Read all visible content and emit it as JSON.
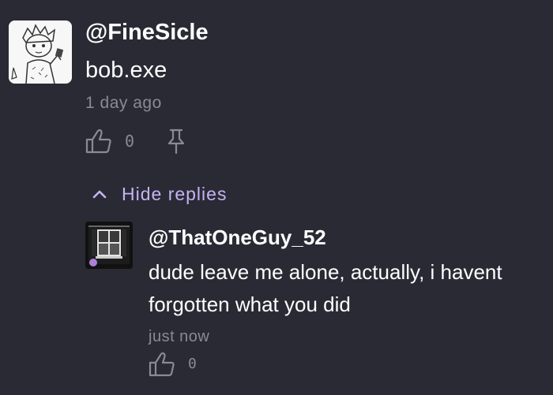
{
  "comment": {
    "username": "@FineSicle",
    "text": "bob.exe",
    "timestamp": "1 day ago",
    "like_count": "0",
    "like_icon": "thumbs-up-icon",
    "pin_icon": "pin-icon",
    "avatar": "sketch-avatar"
  },
  "replies_toggle": {
    "label": "Hide replies",
    "icon": "chevron-up-icon",
    "color": "#c7b3f2"
  },
  "reply": {
    "username": "@ThatOneGuy_52",
    "text": "dude leave me alone, actually, i havent forgotten what you did",
    "timestamp": "just now",
    "like_count": "0",
    "like_icon": "thumbs-up-icon",
    "avatar": "window-photo-avatar"
  },
  "colors": {
    "background": "#2a2a35",
    "text_primary": "#ffffff",
    "text_secondary": "#8a8a90",
    "accent": "#c7b3f2"
  }
}
